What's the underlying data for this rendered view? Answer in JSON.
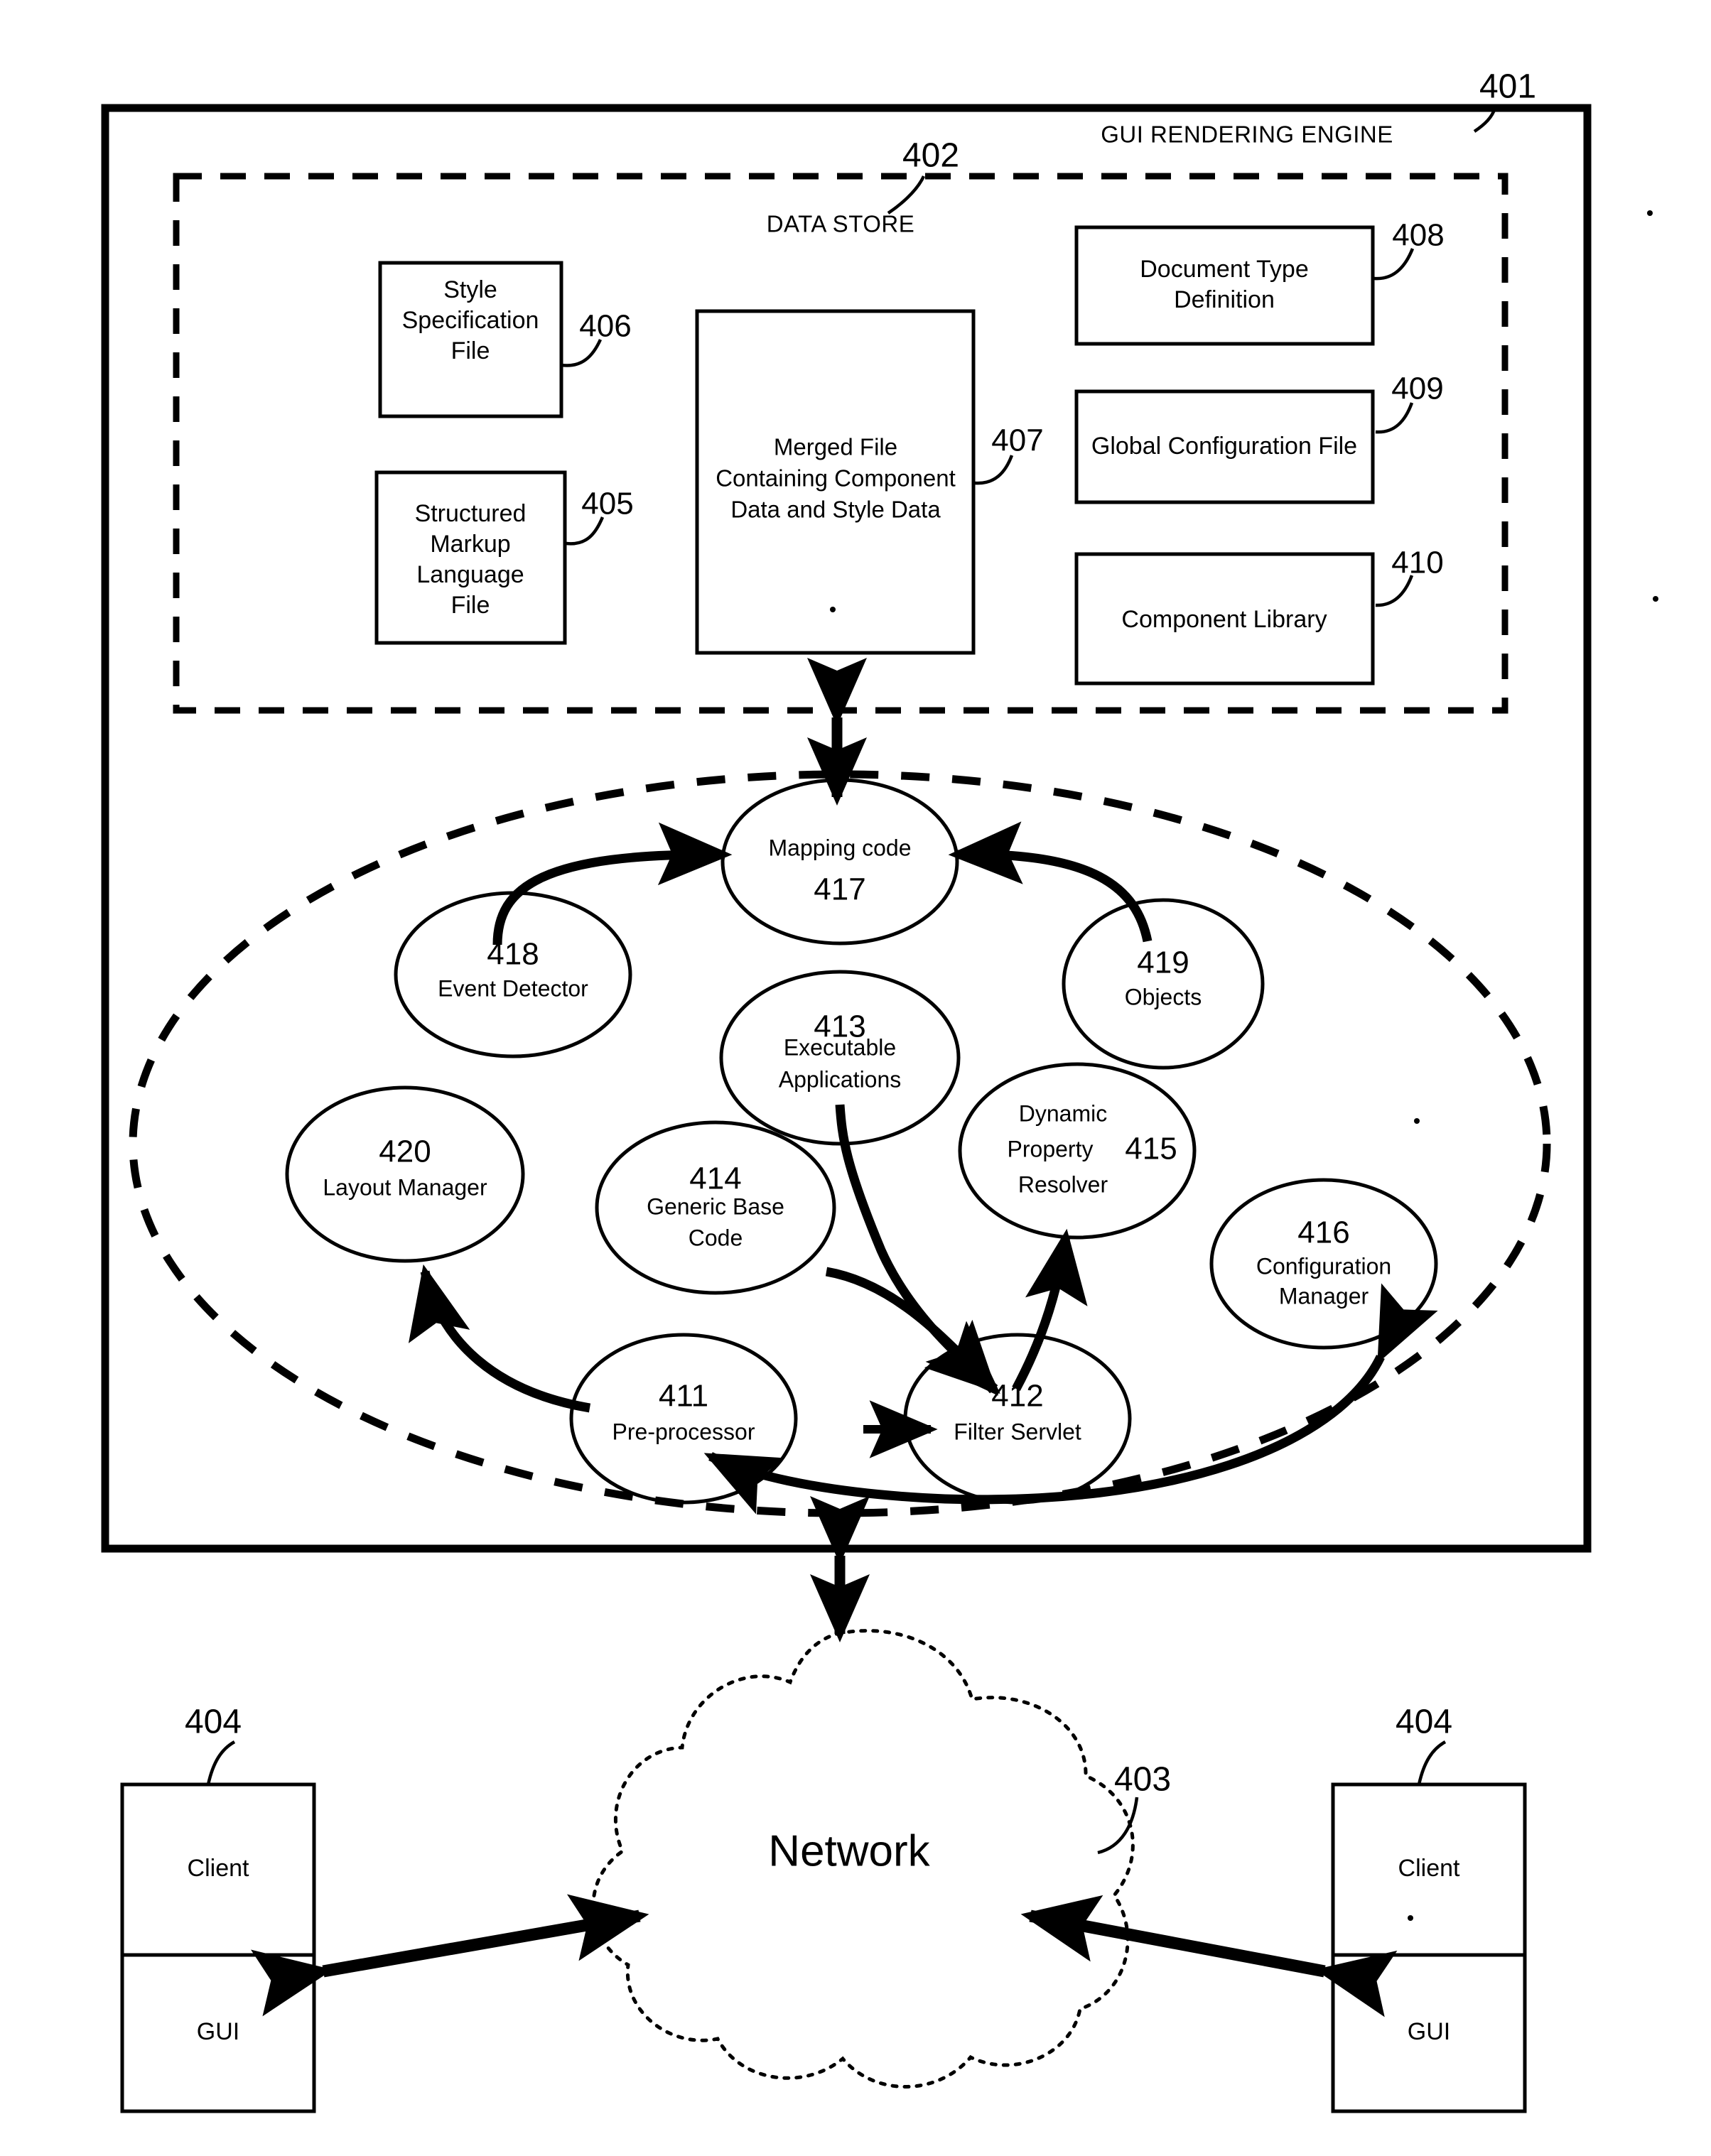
{
  "figure": {
    "outer_container": {
      "ref": "401",
      "label": "GUI RENDERING ENGINE"
    },
    "data_store": {
      "ref": "402",
      "label": "DATA STORE",
      "boxes": [
        {
          "ref": "406",
          "label": "Style Specification File",
          "lines": [
            "Style",
            "Specification",
            "File"
          ]
        },
        {
          "ref": "405",
          "label": "Structured Markup Language File",
          "lines": [
            "Structured",
            "Markup",
            "Language",
            "File"
          ]
        },
        {
          "ref": "407",
          "label": "Merged File Containing Component Data and Style Data",
          "lines": [
            "Merged File",
            "Containing Component",
            "Data and Style Data"
          ]
        },
        {
          "ref": "408",
          "label": "Document Type Definition",
          "lines": [
            "Document Type",
            "Definition"
          ]
        },
        {
          "ref": "409",
          "label": "Global Configuration File",
          "lines": [
            "Global Configuration File"
          ]
        },
        {
          "ref": "410",
          "label": "Component Library",
          "lines": [
            "Component Library"
          ]
        }
      ]
    },
    "engine_ellipse": {
      "nodes": [
        {
          "ref": "417",
          "label": "Mapping code",
          "lines": [
            "Mapping code",
            "417"
          ],
          "ref_position": "below"
        },
        {
          "ref": "418",
          "label": "Event Detector",
          "lines": [
            "418",
            "Event Detector"
          ],
          "ref_position": "above"
        },
        {
          "ref": "419",
          "label": "Objects",
          "lines": [
            "419",
            "Objects"
          ],
          "ref_position": "above"
        },
        {
          "ref": "413",
          "label": "Executable Applications",
          "lines": [
            "413",
            "Executable",
            "Applications"
          ],
          "ref_position": "above"
        },
        {
          "ref": "415",
          "label": "Dynamic Property Resolver",
          "lines": [
            "Dynamic",
            "Property",
            "Resolver"
          ],
          "ref_position": "inline"
        },
        {
          "ref": "420",
          "label": "Layout Manager",
          "lines": [
            "420",
            "Layout Manager"
          ],
          "ref_position": "above"
        },
        {
          "ref": "414",
          "label": "Generic Base Code",
          "lines": [
            "414",
            "Generic Base",
            "Code"
          ],
          "ref_position": "above"
        },
        {
          "ref": "416",
          "label": "Configuration Manager",
          "lines": [
            "416",
            "Configuration",
            "Manager"
          ],
          "ref_position": "above"
        },
        {
          "ref": "411",
          "label": "Pre-processor",
          "lines": [
            "411",
            "Pre-processor"
          ],
          "ref_position": "above"
        },
        {
          "ref": "412",
          "label": "Filter Servlet",
          "lines": [
            "412",
            "Filter Servlet"
          ],
          "ref_position": "above"
        }
      ]
    },
    "network": {
      "ref": "403",
      "label": "Network"
    },
    "clients": [
      {
        "ref": "404",
        "top_label": "Client",
        "bottom_label": "GUI",
        "side": "left"
      },
      {
        "ref": "404",
        "top_label": "Client",
        "bottom_label": "GUI",
        "side": "right"
      }
    ],
    "colors": {
      "stroke": "#000000",
      "background": "#ffffff"
    }
  }
}
